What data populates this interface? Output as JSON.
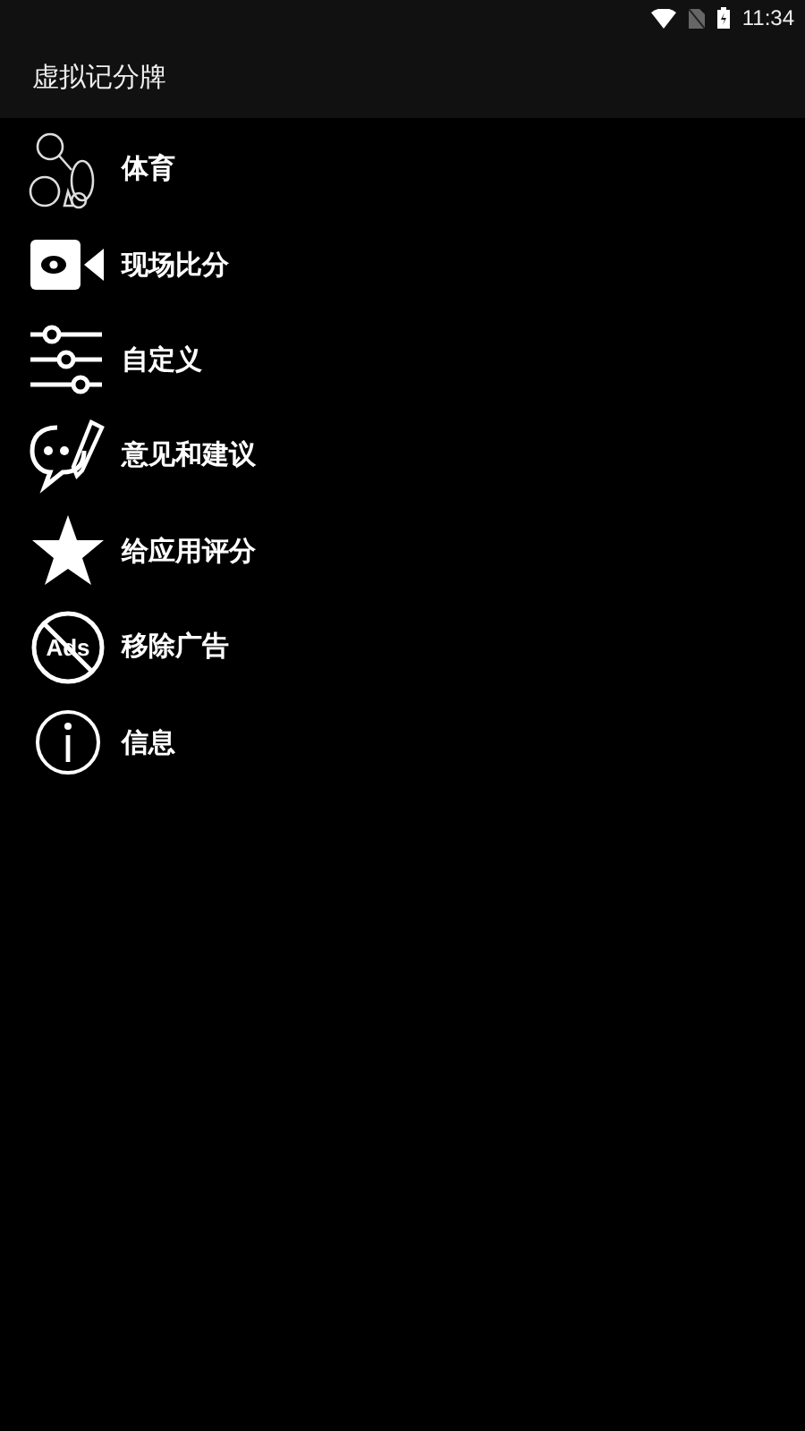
{
  "status_bar": {
    "time": "11:34"
  },
  "app_bar": {
    "title": "虚拟记分牌"
  },
  "menu": [
    {
      "kind": "sports",
      "label": "体育"
    },
    {
      "kind": "camera",
      "label": "现场比分"
    },
    {
      "kind": "sliders",
      "label": "自定义"
    },
    {
      "kind": "feedback",
      "label": "意见和建议"
    },
    {
      "kind": "star",
      "label": "给应用评分"
    },
    {
      "kind": "noads",
      "label": "移除广告",
      "icon_text": "Ads"
    },
    {
      "kind": "info",
      "label": "信息"
    }
  ]
}
